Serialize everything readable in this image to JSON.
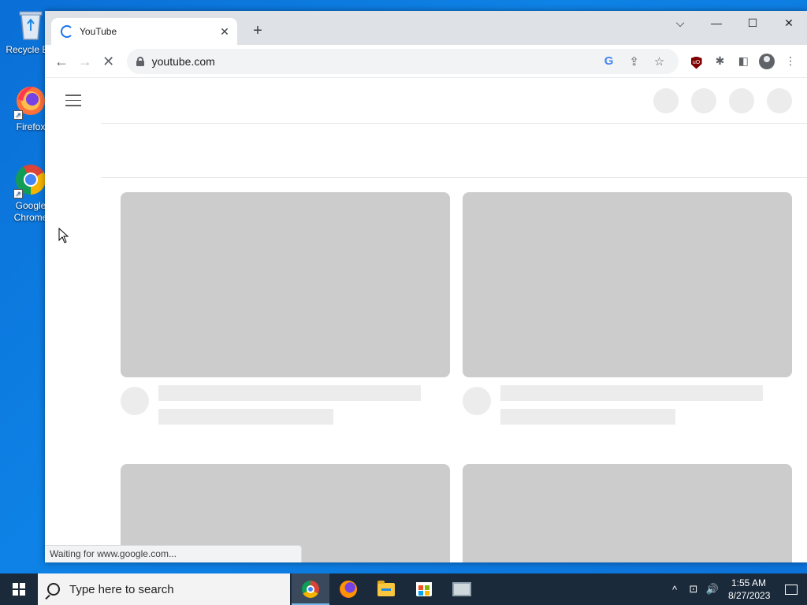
{
  "desktop": {
    "icons": [
      {
        "label": "Recycle Bin",
        "icon": "recycle-bin-icon"
      },
      {
        "label": "Firefox",
        "icon": "firefox-icon"
      },
      {
        "label": "Google Chrome",
        "icon": "chrome-icon"
      }
    ]
  },
  "browser": {
    "tab": {
      "title": "YouTube",
      "favicon": "loading-spinner-icon"
    },
    "new_tab_label": "+",
    "window_controls": {
      "chevron": "⌵",
      "minimize": "—",
      "maximize": "☐",
      "close": "✕"
    },
    "toolbar": {
      "back": "←",
      "forward": "→",
      "stop": "✕",
      "url": "youtube.com",
      "google_lens": "G",
      "share": "⇪",
      "bookmark": "☆",
      "ublock_label": "uO",
      "extensions": "✱",
      "sidepanel": "◧",
      "menu": "⋮"
    },
    "status_text": "Waiting for www.google.com..."
  },
  "taskbar": {
    "search_placeholder": "Type here to search",
    "apps": [
      "chrome",
      "firefox",
      "file-explorer",
      "microsoft-store",
      "remote-desktop"
    ],
    "tray": {
      "chevron": "^",
      "network": "⊡",
      "volume": "🔊"
    },
    "time": "1:55 AM",
    "date": "8/27/2023"
  },
  "colors": {
    "desktop_bg": "#0b72d9",
    "skeleton_dark": "#cccccc",
    "skeleton_light": "#ececec",
    "taskbar": "#1b2a3a"
  }
}
